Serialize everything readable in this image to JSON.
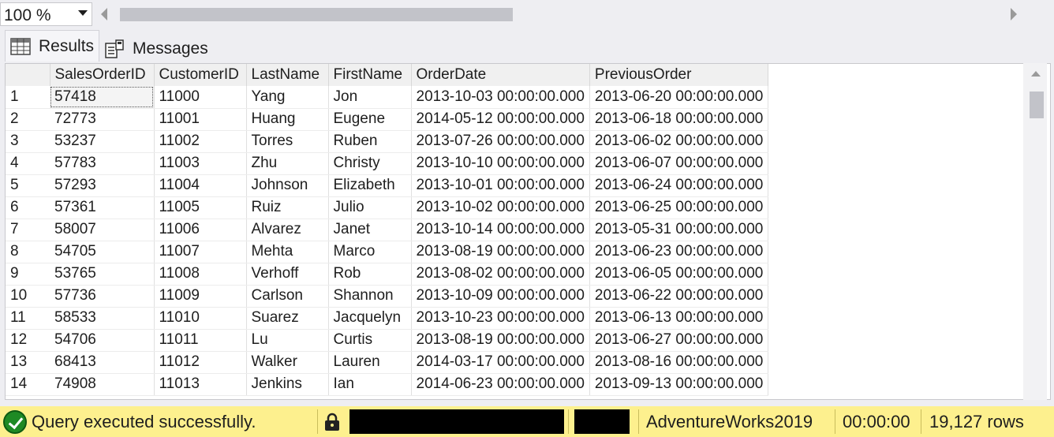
{
  "zoom": {
    "value": "100 %"
  },
  "tabs": [
    {
      "label": "Results"
    },
    {
      "label": "Messages"
    }
  ],
  "grid": {
    "columns": [
      "",
      "SalesOrderID",
      "CustomerID",
      "LastName",
      "FirstName",
      "OrderDate",
      "PreviousOrder"
    ],
    "rows": [
      [
        "1",
        "57418",
        "11000",
        "Yang",
        "Jon",
        "2013-10-03 00:00:00.000",
        "2013-06-20 00:00:00.000"
      ],
      [
        "2",
        "72773",
        "11001",
        "Huang",
        "Eugene",
        "2014-05-12 00:00:00.000",
        "2013-06-18 00:00:00.000"
      ],
      [
        "3",
        "53237",
        "11002",
        "Torres",
        "Ruben",
        "2013-07-26 00:00:00.000",
        "2013-06-02 00:00:00.000"
      ],
      [
        "4",
        "57783",
        "11003",
        "Zhu",
        "Christy",
        "2013-10-10 00:00:00.000",
        "2013-06-07 00:00:00.000"
      ],
      [
        "5",
        "57293",
        "11004",
        "Johnson",
        "Elizabeth",
        "2013-10-01 00:00:00.000",
        "2013-06-24 00:00:00.000"
      ],
      [
        "6",
        "57361",
        "11005",
        "Ruiz",
        "Julio",
        "2013-10-02 00:00:00.000",
        "2013-06-25 00:00:00.000"
      ],
      [
        "7",
        "58007",
        "11006",
        "Alvarez",
        "Janet",
        "2013-10-14 00:00:00.000",
        "2013-05-31 00:00:00.000"
      ],
      [
        "8",
        "54705",
        "11007",
        "Mehta",
        "Marco",
        "2013-08-19 00:00:00.000",
        "2013-06-23 00:00:00.000"
      ],
      [
        "9",
        "53765",
        "11008",
        "Verhoff",
        "Rob",
        "2013-08-02 00:00:00.000",
        "2013-06-05 00:00:00.000"
      ],
      [
        "10",
        "57736",
        "11009",
        "Carlson",
        "Shannon",
        "2013-10-09 00:00:00.000",
        "2013-06-22 00:00:00.000"
      ],
      [
        "11",
        "58533",
        "11010",
        "Suarez",
        "Jacquelyn",
        "2013-10-23 00:00:00.000",
        "2013-06-13 00:00:00.000"
      ],
      [
        "12",
        "54706",
        "11011",
        "Lu",
        "Curtis",
        "2013-08-19 00:00:00.000",
        "2013-06-27 00:00:00.000"
      ],
      [
        "13",
        "68413",
        "11012",
        "Walker",
        "Lauren",
        "2014-03-17 00:00:00.000",
        "2013-08-16 00:00:00.000"
      ],
      [
        "14",
        "74908",
        "11013",
        "Jenkins",
        "Ian",
        "2014-06-23 00:00:00.000",
        "2013-09-13 00:00:00.000"
      ]
    ]
  },
  "status": {
    "message": "Query executed successfully.",
    "database": "AdventureWorks2019",
    "elapsed": "00:00:00",
    "rows": "19,127 rows",
    "bar_color": "#fdf08e",
    "success_icon": "check-circle-icon",
    "lock_icon": "lock-icon"
  }
}
